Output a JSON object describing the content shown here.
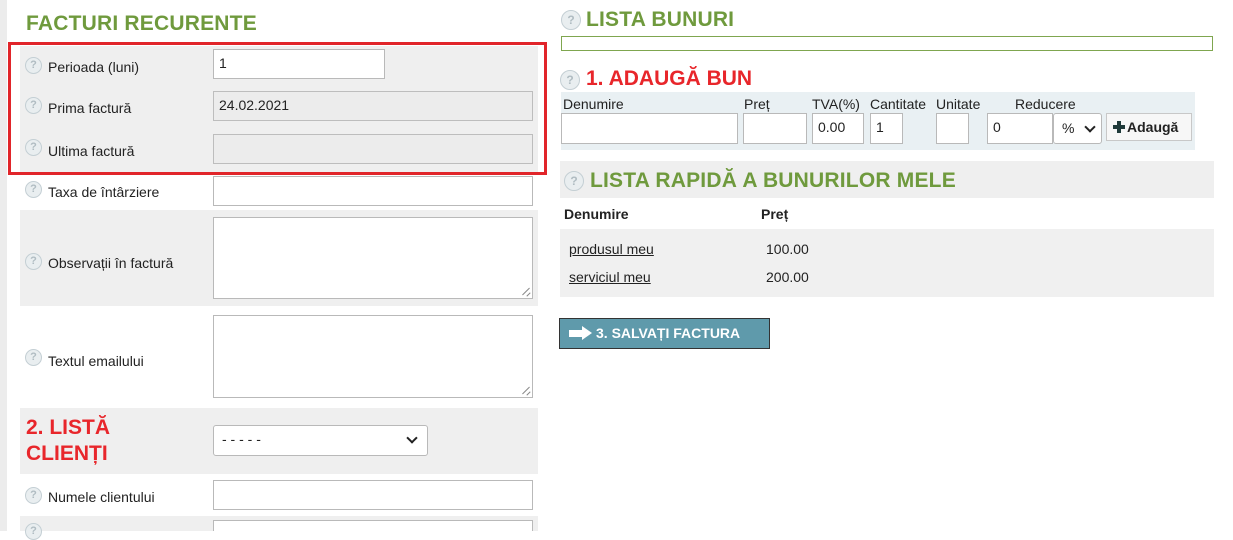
{
  "recurring": {
    "title": "FACTURI RECURENTE",
    "period_label": "Perioada (luni)",
    "period_value": "1",
    "first_invoice_label": "Prima factură",
    "first_invoice_value": "24.02.2021",
    "last_invoice_label": "Ultima factură",
    "last_invoice_value": ""
  },
  "invoice_fields": {
    "late_fee_label": "Taxa de întârziere",
    "notes_label": "Observații în factură",
    "email_text_label": "Textul emailului"
  },
  "clients": {
    "title_line1": "2. LISTĂ",
    "title_line2": "CLIENȚI",
    "selected_client": "- - - - -",
    "client_name_label": "Numele clientului"
  },
  "goods": {
    "title": "LISTA BUNURI"
  },
  "add_good": {
    "title": "1. ADAUGĂ BUN",
    "col_name": "Denumire",
    "col_price": "Preț",
    "col_vat": "TVA(%)",
    "col_qty": "Cantitate",
    "col_unit": "Unitate",
    "col_discount": "Reducere",
    "vat_value": "0.00",
    "qty_value": "1",
    "discount_value": "0",
    "discount_type": "%",
    "add_button": "Adaugă"
  },
  "quick_list": {
    "title": "LISTA RAPIDĂ A BUNURILOR MELE",
    "col_name": "Denumire",
    "col_price": "Preț",
    "items": [
      {
        "name": "produsul meu",
        "price": "100.00"
      },
      {
        "name": "serviciul meu",
        "price": "200.00"
      }
    ]
  },
  "save_button": "3. SALVAȚI FACTURA",
  "colors": {
    "section_green": "#6f9a3d",
    "accent_red": "#e8262b",
    "save_button_bg": "#5f9aab"
  }
}
